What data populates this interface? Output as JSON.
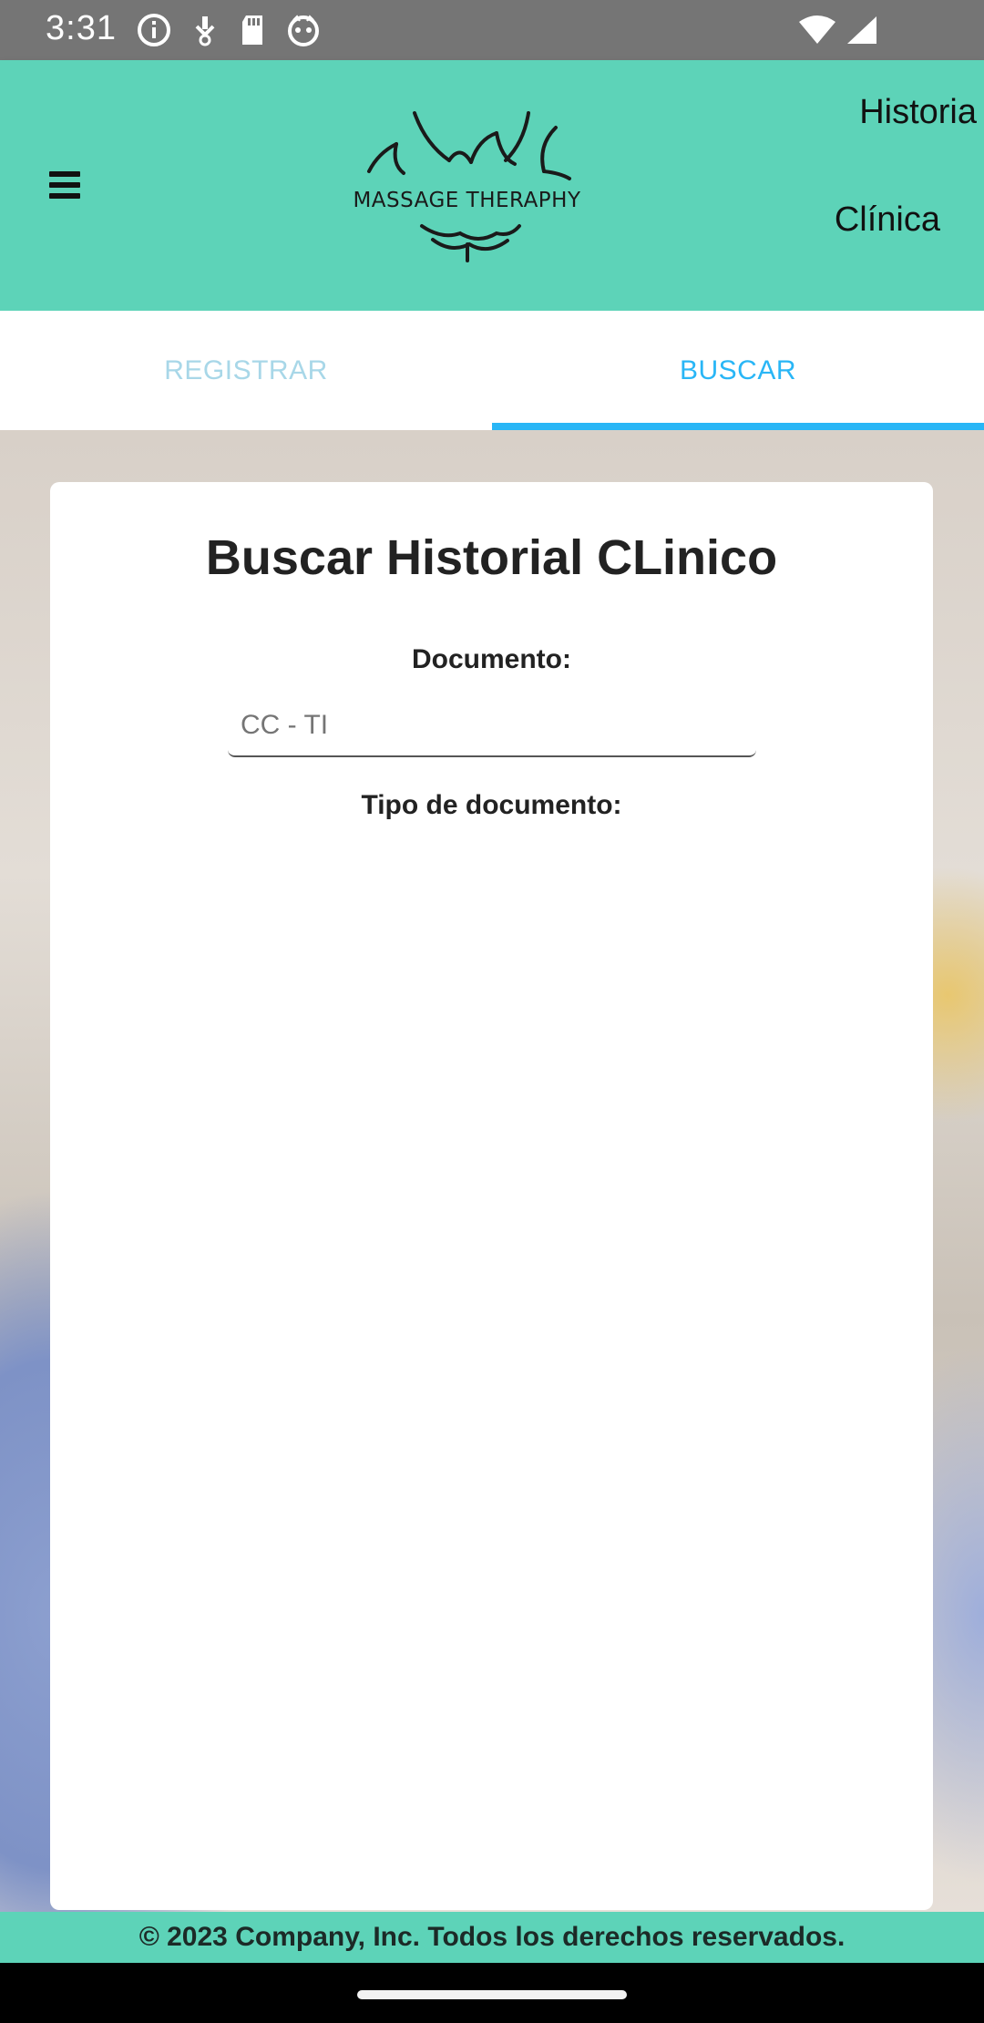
{
  "status_bar": {
    "time": "3:31",
    "icons_left": [
      "info-icon",
      "download-icon",
      "sd-card-icon",
      "cat-face-icon"
    ],
    "icons_right": [
      "wifi-icon",
      "cell-signal-icon"
    ]
  },
  "header": {
    "logo_text": "MASSAGE THERAPHY",
    "title_line1": "Historia",
    "title_line2": "Clínica",
    "menu_icon": "hamburger-menu-icon",
    "colors": {
      "background": "#5dd3b8"
    }
  },
  "tabs": [
    {
      "label": "REGISTRAR",
      "active": false
    },
    {
      "label": "BUSCAR",
      "active": true
    }
  ],
  "tab_colors": {
    "active": "#29b6f6",
    "inactive": "#a8d7e8"
  },
  "search_card": {
    "title": "Buscar Historial CLinico",
    "document_label": "Documento:",
    "document_placeholder": "CC - TI",
    "document_type_label": "Tipo de documento:"
  },
  "footer": {
    "text": "© 2023 Company, Inc. Todos los derechos reservados."
  }
}
